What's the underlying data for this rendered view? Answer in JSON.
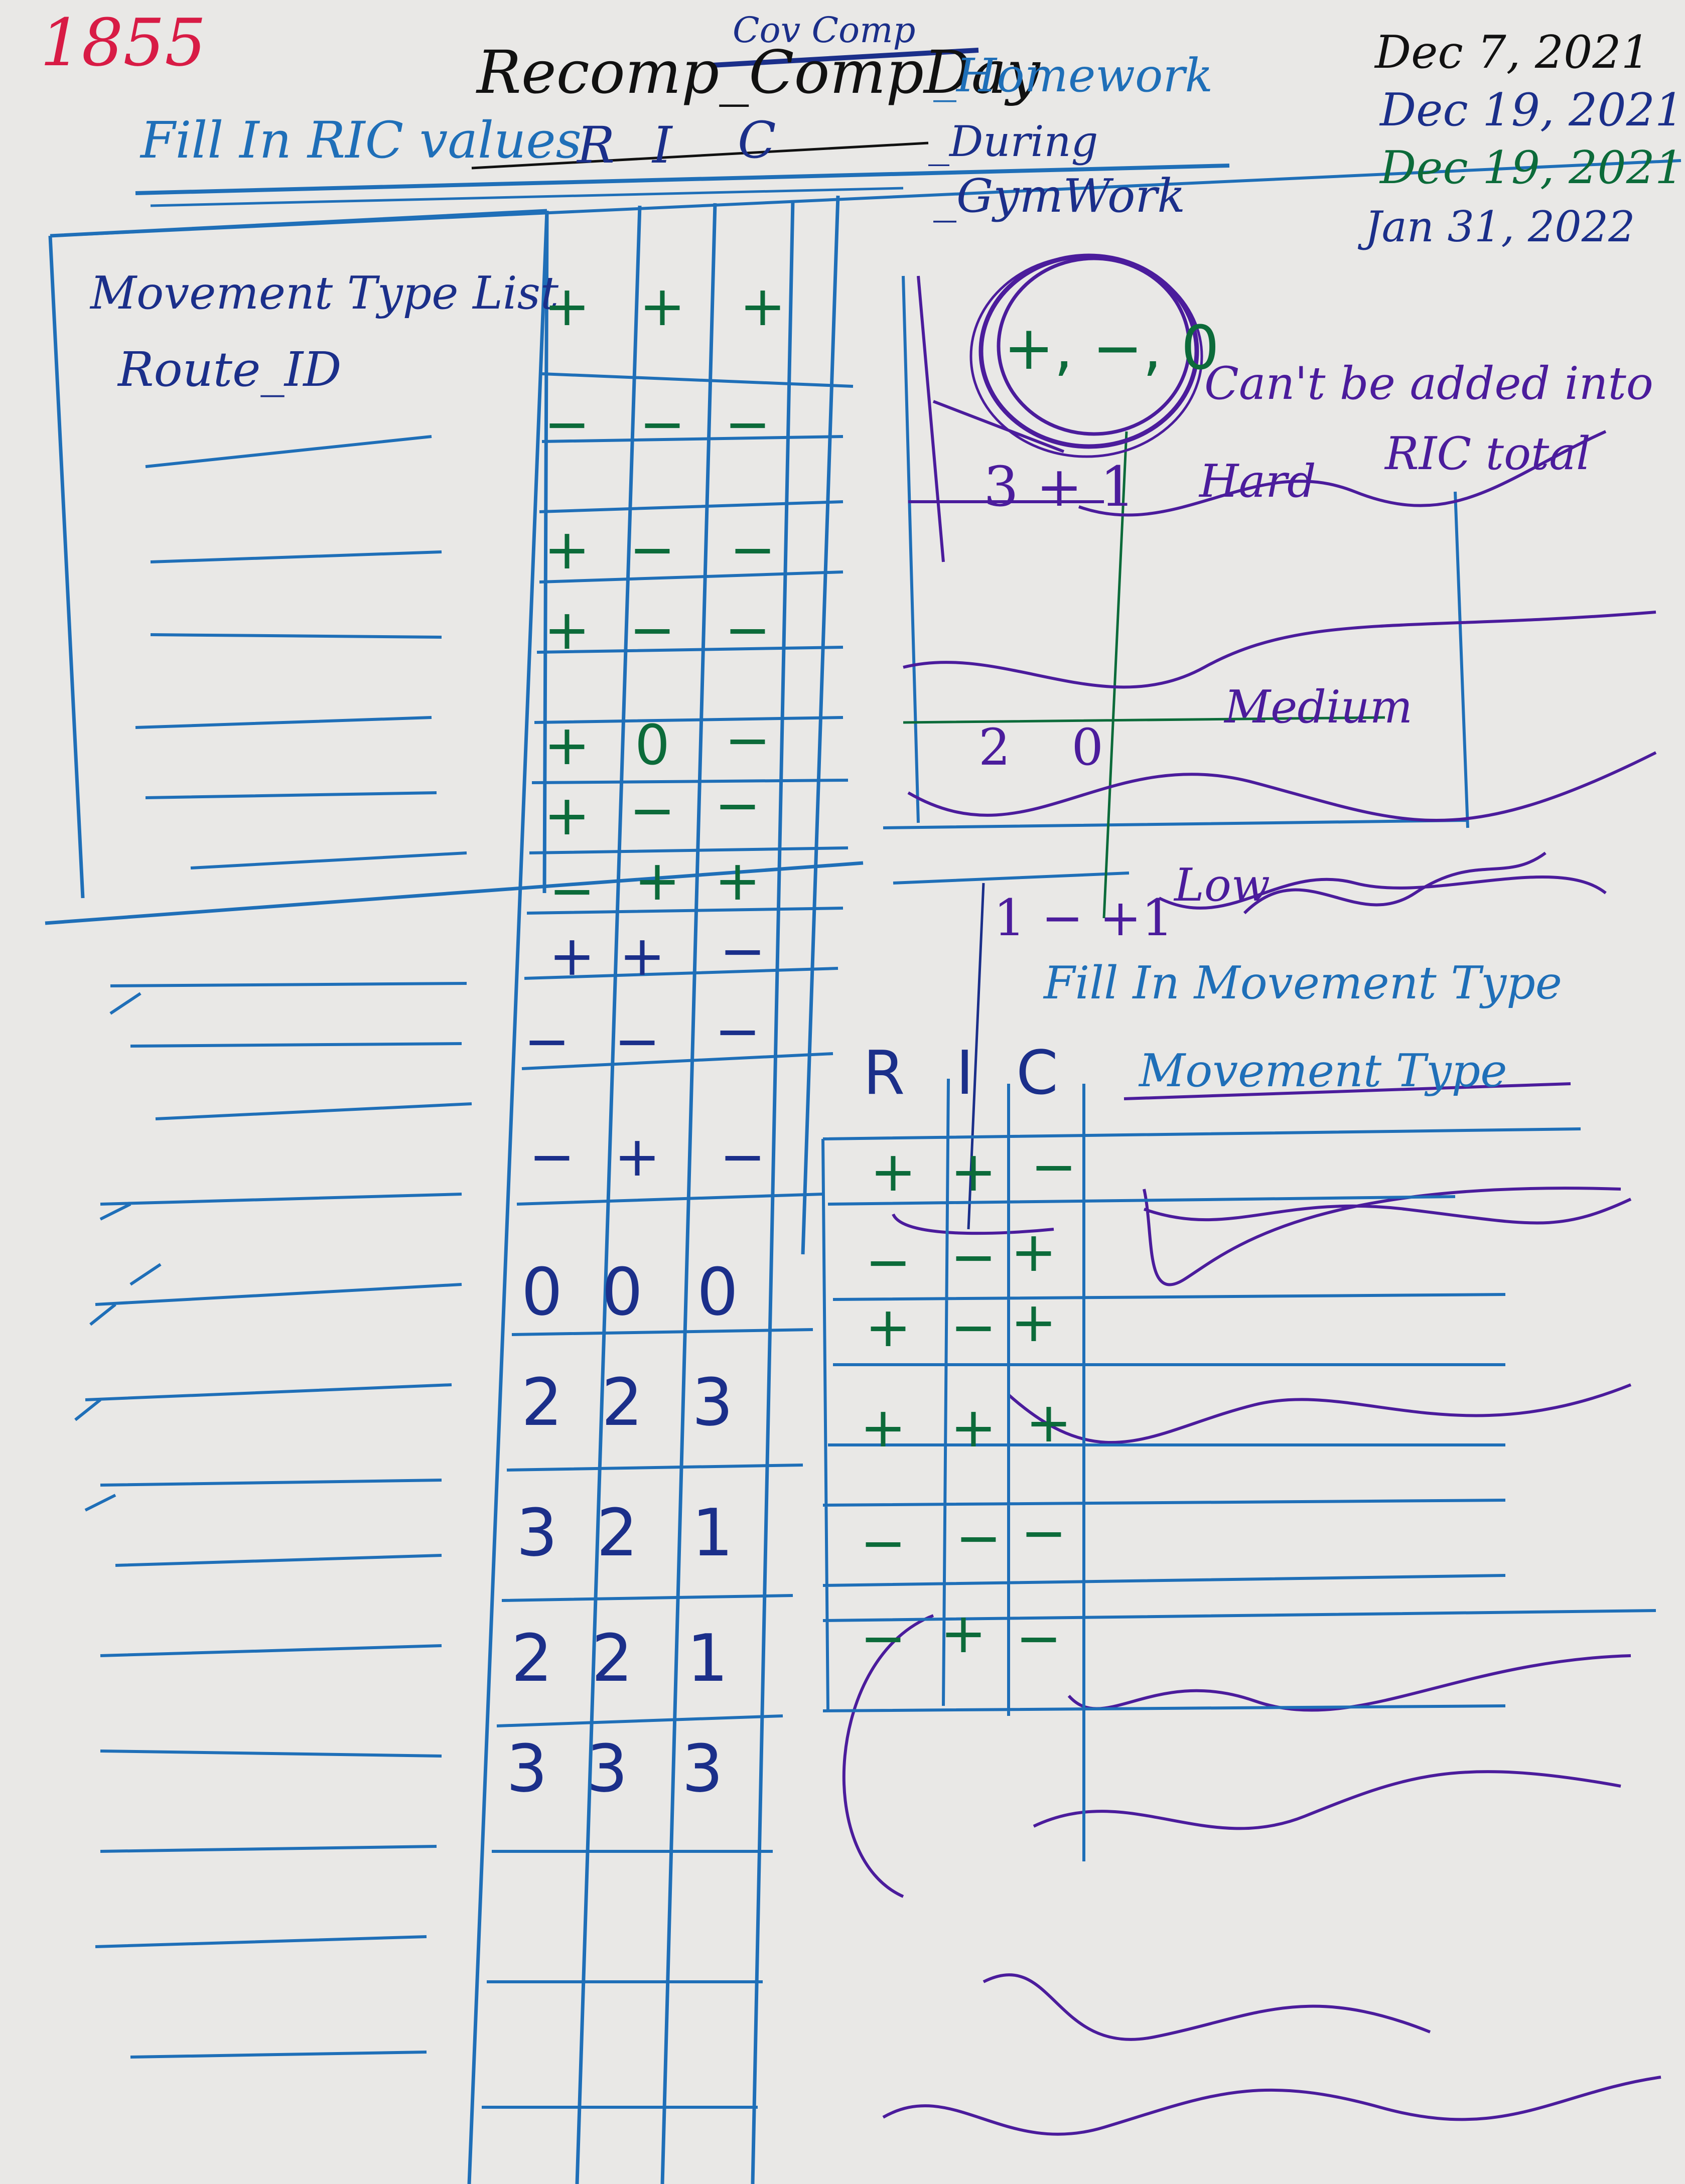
{
  "page_number": "1855",
  "header": {
    "title": "Recomp_CompDay",
    "title_overline": "Cov Comp",
    "fill_in_ric_values": "Fill In RIC values",
    "ric_header": [
      "R",
      "I",
      "C"
    ],
    "homework": "_Homework",
    "during": "_During",
    "gym_work": "_GymWork"
  },
  "dates": [
    "Dec 7, 2021",
    "Dec 19, 2021",
    "Dec 19, 2021",
    "Jan 31, 2022"
  ],
  "left_box": {
    "movement_type_list": "Movement Type List",
    "route_id": "Route_ID"
  },
  "ric_table_rows": [
    [
      "+",
      "+",
      "+"
    ],
    [
      "−",
      "−",
      "−"
    ],
    [
      "+",
      "−",
      "−"
    ],
    [
      "+",
      "−",
      "−"
    ],
    [
      "+",
      "0",
      "−"
    ],
    [
      "+",
      "−",
      "−"
    ],
    [
      "−",
      "+",
      "+"
    ],
    [
      "+",
      "+",
      "−"
    ],
    [
      "−",
      "−",
      "−"
    ],
    [
      "−",
      "+",
      "−"
    ],
    [
      "0",
      "0",
      "0"
    ],
    [
      "2",
      "2",
      "3"
    ],
    [
      "3",
      "2",
      "1"
    ],
    [
      "2",
      "2",
      "1"
    ],
    [
      "3",
      "3",
      "3"
    ]
  ],
  "scale": {
    "circled_note": "+, −, 0",
    "note_line1": "Can't be added into",
    "note_line2": "RIC total",
    "hard_label": "Hard",
    "hard_values": "3 + 1",
    "medium_label": "Medium",
    "medium_values": "2 0",
    "low_label": "Low",
    "low_values": "1 − +1"
  },
  "movement_section": {
    "fill_in_movement_type": "Fill In Movement Type",
    "headers": [
      "R",
      "I",
      "C"
    ],
    "movement_type_label": "Movement Type",
    "rows": [
      [
        "+",
        "+",
        "−"
      ],
      [
        "−",
        "−",
        "+"
      ],
      [
        "+",
        "−",
        "+"
      ],
      [
        "+",
        "+",
        "+"
      ],
      [
        "−",
        "−",
        "−"
      ],
      [
        "−",
        "+",
        "−"
      ]
    ]
  },
  "colors": {
    "paper": "#e9e8e6",
    "blue_ink": "#1f6fb8",
    "navy_ink": "#1b2f8a",
    "green_ink": "#0c6b3a",
    "purple_ink": "#4b1c9c",
    "red_ink": "#d81b45"
  }
}
